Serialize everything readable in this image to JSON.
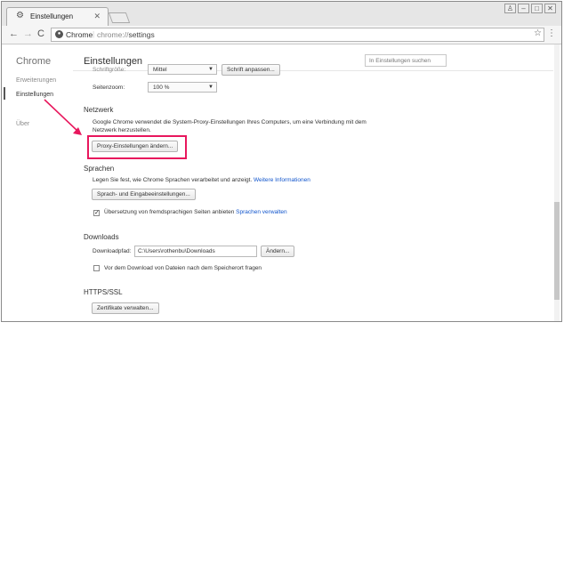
{
  "tab": {
    "title": "Einstellungen",
    "icon": "gear-icon"
  },
  "omnibox": {
    "origin": "Chrome",
    "url_scheme": "chrome://",
    "url_path": "settings"
  },
  "sidebar": {
    "title": "Chrome",
    "items": [
      {
        "label": "Erweiterungen"
      },
      {
        "label": "Einstellungen"
      },
      {
        "label": "Über"
      }
    ]
  },
  "main": {
    "title": "Einstellungen",
    "search_placeholder": "In Einstellungen suchen",
    "font_size": {
      "label": "Schriftgröße:",
      "value": "Mittel",
      "button": "Schrift anpassen..."
    },
    "zoom": {
      "label": "Seitenzoom:",
      "value": "100 %"
    },
    "network": {
      "heading": "Netzwerk",
      "text": "Google Chrome verwendet die System-Proxy-Einstellungen Ihres Computers, um eine Verbindung mit dem Netzwerk herzustellen.",
      "button": "Proxy-Einstellungen ändern..."
    },
    "languages": {
      "heading": "Sprachen",
      "text": "Legen Sie fest, wie Chrome Sprachen verarbeitet und anzeigt.",
      "link": "Weitere Informationen",
      "button": "Sprach- und Eingabeeinstellungen...",
      "translate_label": "Übersetzung von fremdsprachigen Seiten anbieten",
      "translate_link": "Sprachen verwalten"
    },
    "downloads": {
      "heading": "Downloads",
      "path_label": "Downloadpfad:",
      "path_value": "C:\\Users\\rothenbu\\Downloads",
      "change_button": "Ändern...",
      "ask_label": "Vor dem Download von Dateien nach dem Speicherort fragen"
    },
    "https": {
      "heading": "HTTPS/SSL",
      "button": "Zertifikate verwalten..."
    }
  },
  "colors": {
    "highlight": "#e8175d",
    "link": "#1155cc"
  }
}
